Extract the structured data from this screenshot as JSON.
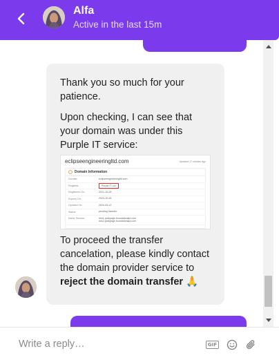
{
  "colors": {
    "accent": "#7c3aed",
    "highlight_box": "#d9302c"
  },
  "header": {
    "back_icon": "chevron-left-icon",
    "agent_name": "Alfa",
    "status": "Active in the last 15m"
  },
  "message": {
    "paragraph_1": "Thank you so much for your patience.",
    "paragraph_2": "Upon checking, I can see that your domain was under this Purple IT service:",
    "paragraph_3_start": "To proceed the transfer cancelation, please kindly contact the domain provider service to ",
    "paragraph_3_bold": "reject the domain transfer",
    "paragraph_3_emoji": "🙏"
  },
  "attachment": {
    "domain": "eclipseengineeringltd.com",
    "updated": "Updated 17 minutes ago",
    "card_title": "Domain Information",
    "rows": [
      {
        "key": "Domain:",
        "value": "eclipseengineeringltd.com"
      },
      {
        "key": "Registrar:",
        "value": "Purple IT Ltd"
      },
      {
        "key": "Registered On:",
        "value": "2021-10-26"
      },
      {
        "key": "Expires On:",
        "value": "2024-10-26"
      },
      {
        "key": "Updated On:",
        "value": "2024-03-12"
      },
      {
        "key": "Status:",
        "value": "pending transfer"
      },
      {
        "key": "Name Servers:",
        "value": "dns1.parkpage.foundationapi.com\ndns2.parkpage.foundationapi.com"
      }
    ]
  },
  "composer": {
    "placeholder": "Write a reply…",
    "gif_label": "GIF",
    "emoji_icon": "smiley-icon",
    "attach_icon": "paperclip-icon"
  }
}
